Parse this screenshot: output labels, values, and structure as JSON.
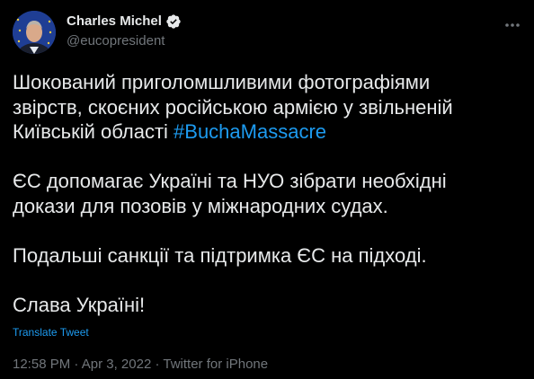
{
  "tweet": {
    "author": {
      "display_name": "Charles Michel",
      "handle": "@eucopresident",
      "verified": true,
      "avatar_icon": "avatar-photo",
      "verified_icon": "verified-badge-icon"
    },
    "more_icon": "more-dots-icon",
    "paragraphs": [
      {
        "line1": "Шокований приголомшливими фотографіями",
        "line2": "звірств, скоєних російською армією у звільненій",
        "line3_text": "Київській області ",
        "line3_hashtag": "#BuchaMassacre"
      },
      {
        "line1": "ЄС допомагає Україні та НУО зібрати необхідні",
        "line2": "докази для позовів у міжнародних судах."
      },
      {
        "line1": "Подальші санкції та підтримка ЄС на підході."
      },
      {
        "line1": "Слава Україні!"
      }
    ],
    "translate_link": "Translate Tweet",
    "time": "12:58 PM",
    "date": "Apr 3, 2022",
    "source": "Twitter for iPhone",
    "separator": "·"
  },
  "colors": {
    "background": "#000000",
    "text_primary": "#e7e9ea",
    "text_secondary": "#71767b",
    "accent": "#1d9bf0"
  }
}
